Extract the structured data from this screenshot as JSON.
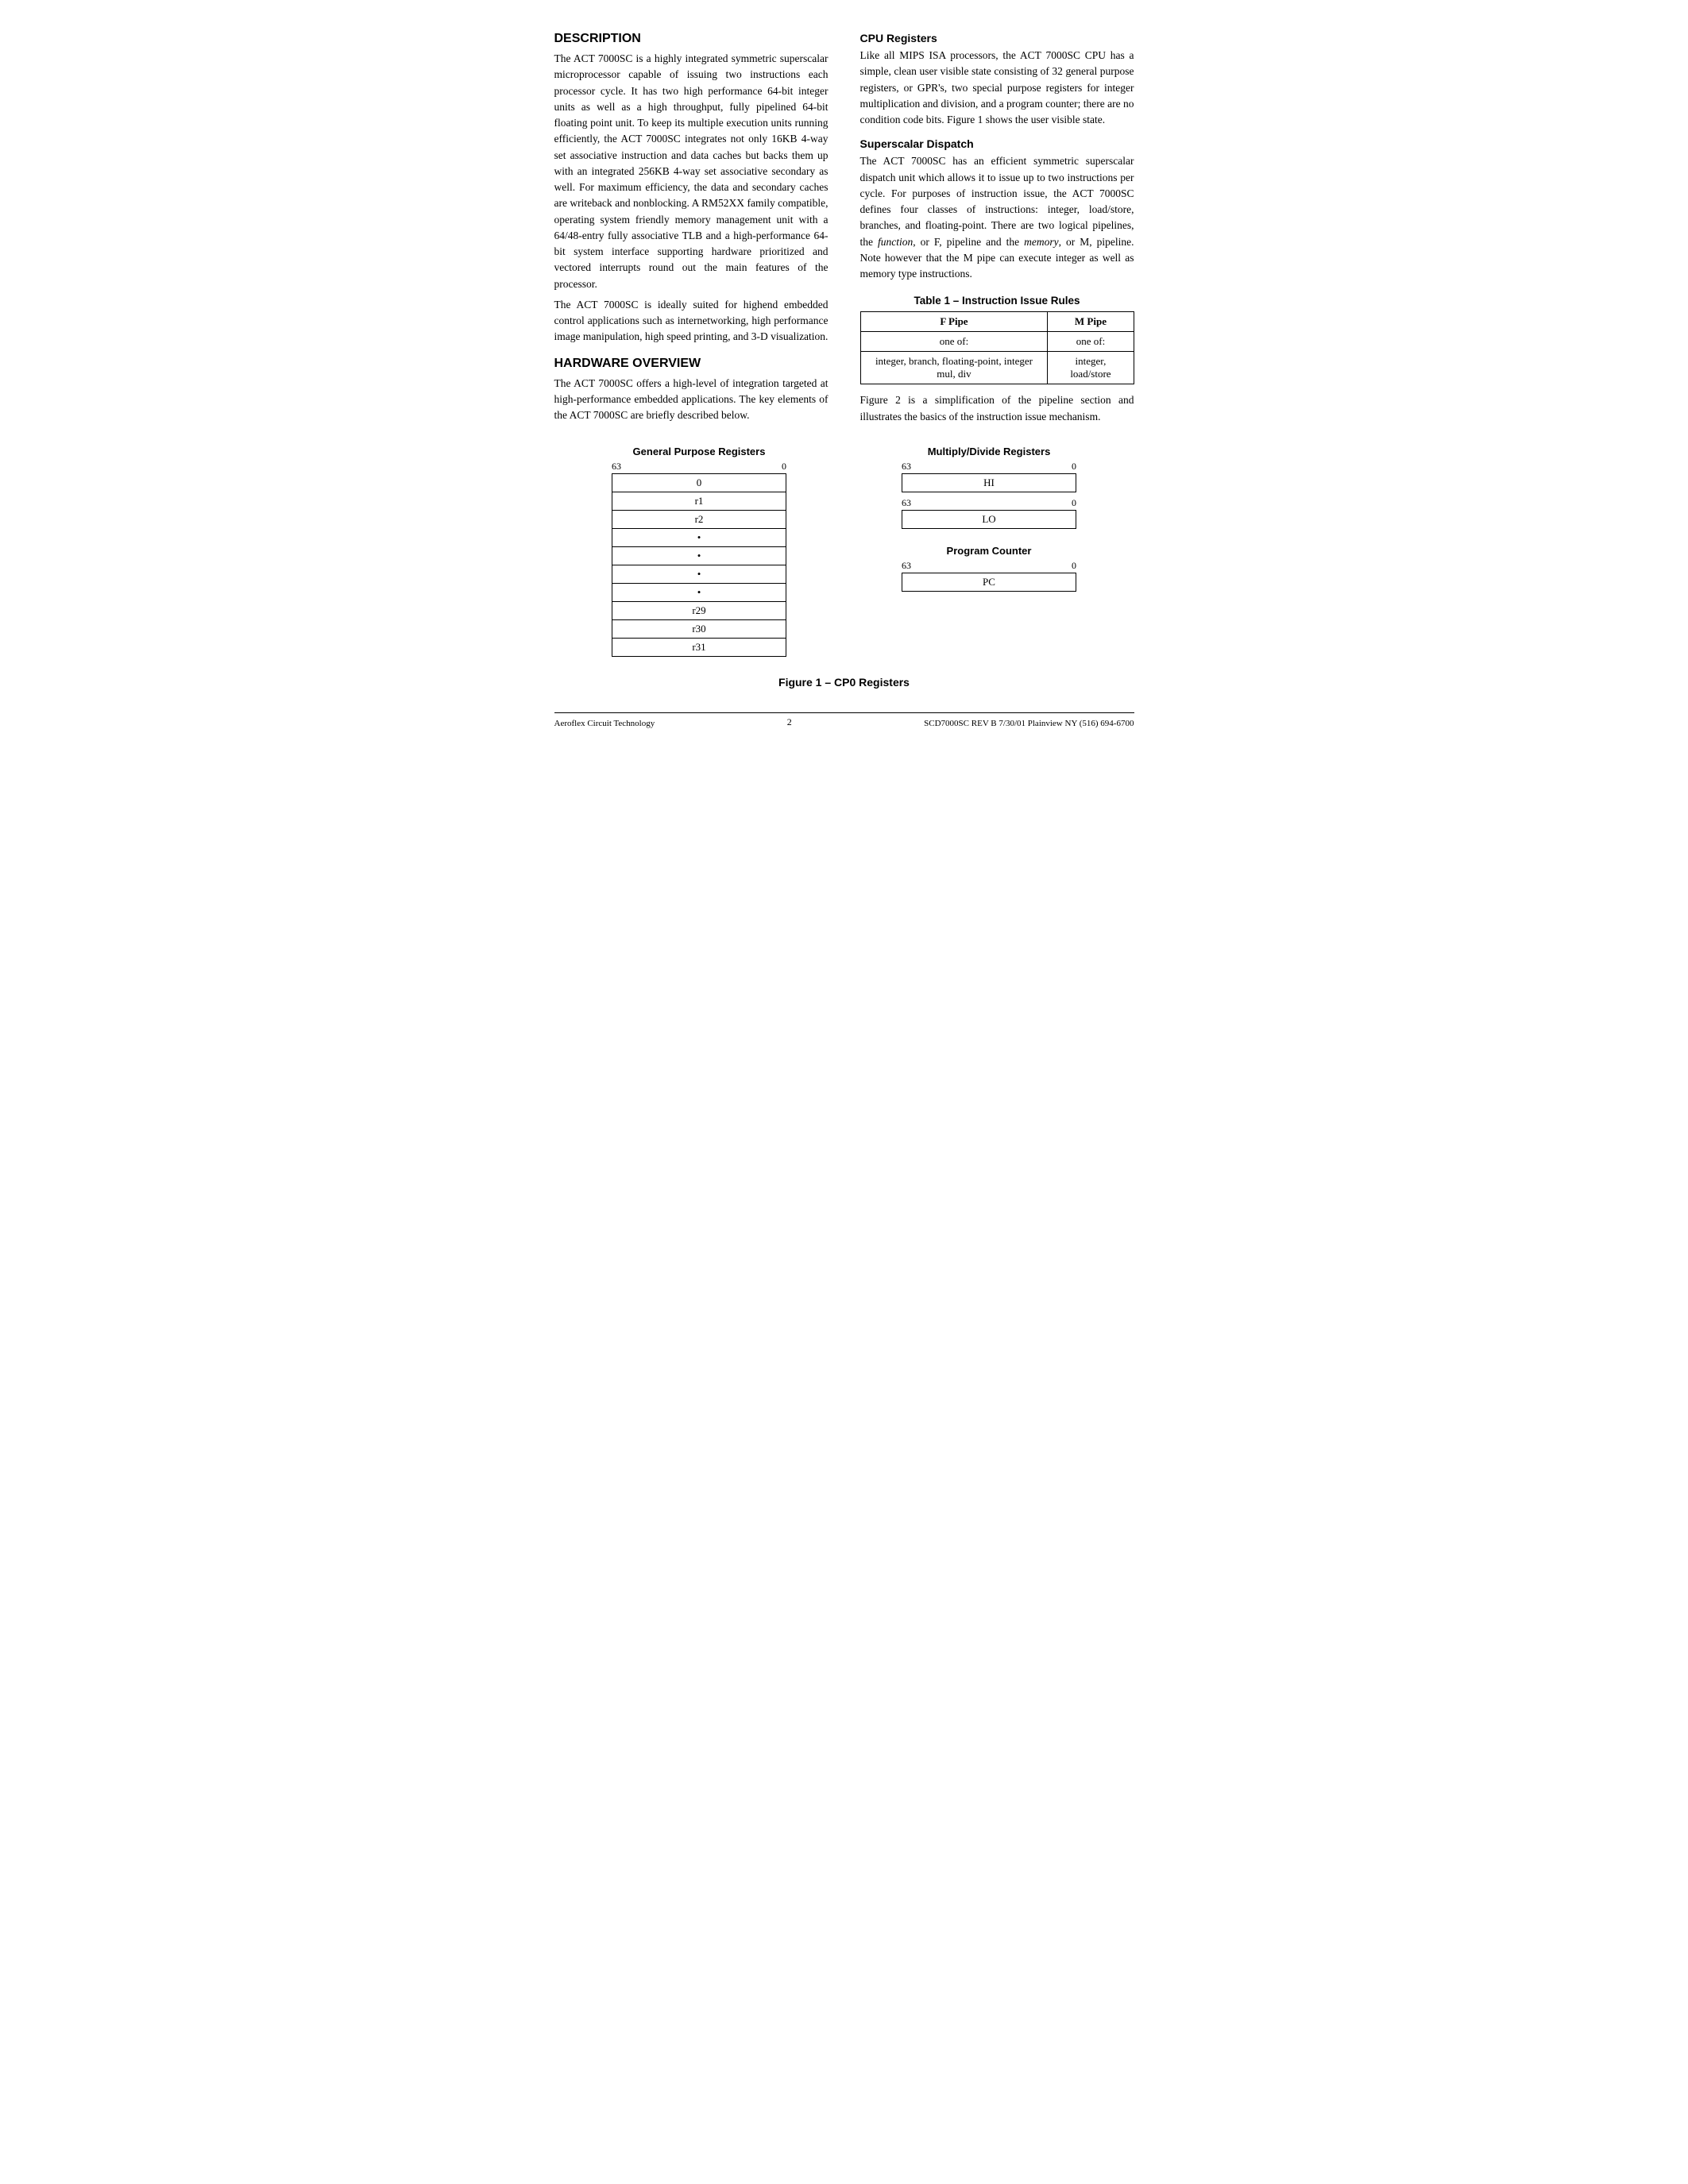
{
  "page": {
    "footer": {
      "left": "Aeroflex Circuit Technology",
      "center": "2",
      "right": "SCD7000SC REV B  7/30/01  Plainview NY (516) 694-6700"
    }
  },
  "description": {
    "title": "DESCRIPTION",
    "paragraphs": [
      "The ACT 7000SC is a highly integrated symmetric superscalar microprocessor capable of issuing two instructions each processor cycle. It has two high performance 64-bit integer units as well as a high throughput, fully pipelined 64-bit floating point unit. To keep its multiple execution units running efficiently, the ACT 7000SC integrates not only 16KB 4-way set associative instruction and data caches but backs them up with an integrated 256KB 4-way set associative secondary as well. For maximum efficiency, the data and secondary caches are writeback and nonblocking. A RM52XX family compatible, operating system friendly memory management unit with a 64/48-entry fully associative TLB and a high-performance 64-bit system interface supporting hardware prioritized and vectored interrupts round out the main features of the processor.",
      "The ACT 7000SC is ideally suited for highend embedded control applications such as internetworking, high performance image manipulation, high speed printing, and 3-D visualization."
    ]
  },
  "hardware": {
    "title": "HARDWARE OVERVIEW",
    "paragraph": "The ACT 7000SC offers a high-level of integration targeted at high-performance embedded applications. The key elements of the ACT 7000SC are briefly described below."
  },
  "cpu_registers": {
    "title": "CPU Registers",
    "paragraph": "Like all MIPS ISA processors, the ACT 7000SC CPU has a simple, clean user visible state consisting of 32 general purpose registers, or GPR's, two special purpose registers for integer multiplication and division, and a program counter; there are no condition code bits. Figure 1 shows the user visible state."
  },
  "superscalar": {
    "title": "Superscalar Dispatch",
    "paragraph": "The ACT 7000SC has an efficient symmetric superscalar dispatch unit which allows it to issue up to two instructions per cycle. For purposes of instruction issue, the ACT 7000SC defines four classes of instructions: integer, load/store, branches, and floating-point. There are two logical pipelines, the function, or F, pipeline and the memory, or M, pipeline. Note however that the M pipe can execute integer as well as memory type instructions."
  },
  "table1": {
    "title": "Table 1 – Instruction Issue Rules",
    "col1_header": "F Pipe",
    "col2_header": "M Pipe",
    "row1_col1": "one of:",
    "row1_col2": "one of:",
    "row2_col1": "integer, branch, floating-point, integer mul, div",
    "row2_col2": "integer, load/store"
  },
  "figure_text": {
    "below_table": "Figure 2 is a simplification of the pipeline section and illustrates the basics of the instruction issue mechanism."
  },
  "gpr": {
    "title": "General Purpose Registers",
    "range_left": "63",
    "range_right": "0",
    "rows": [
      "0",
      "r1",
      "r2",
      "•",
      "•",
      "•",
      "•",
      "r29",
      "r30",
      "r31"
    ]
  },
  "multiply": {
    "title": "Multiply/Divide Registers",
    "hi_range_left": "63",
    "hi_range_right": "0",
    "hi_label": "HI",
    "lo_range_left": "63",
    "lo_range_right": "0",
    "lo_label": "LO"
  },
  "program_counter": {
    "title": "Program Counter",
    "range_left": "63",
    "range_right": "0",
    "label": "PC"
  },
  "figure1": {
    "caption": "Figure 1 – CP0 Registers"
  }
}
